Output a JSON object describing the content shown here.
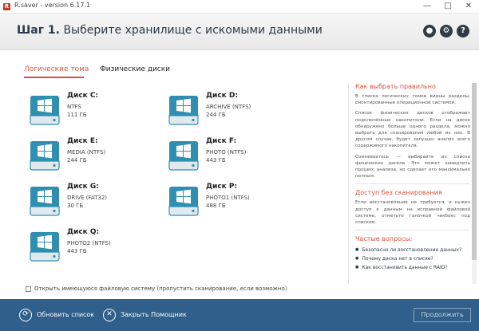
{
  "window": {
    "title": "R.saver - version 6.17.1",
    "logo": "R"
  },
  "header": {
    "step": "Шаг 1.",
    "title": "Выберите хранилище с искомыми данными"
  },
  "tabs": {
    "active": "Логические тома",
    "other": "Физические диски"
  },
  "disks": [
    {
      "name": "Диск C:",
      "fs": "NTFS",
      "size": "111 ГБ"
    },
    {
      "name": "Диск D:",
      "fs": "ARCHIVE (NTFS)",
      "size": "244 ГБ"
    },
    {
      "name": "Диск E:",
      "fs": "MEDIA (NTFS)",
      "size": "244 ГБ"
    },
    {
      "name": "Диск F:",
      "fs": "PHOTO (NTFS)",
      "size": "443 ГБ"
    },
    {
      "name": "Диск G:",
      "fs": "DRIVE (FAT32)",
      "size": "30 ГБ"
    },
    {
      "name": "Диск P:",
      "fs": "PHOTO1 (NTFS)",
      "size": "488 ГБ"
    },
    {
      "name": "Диск Q:",
      "fs": "PHOTO2 (NTFS)",
      "size": "443 ГБ"
    }
  ],
  "checkbox_label": "Открыть имеющуюся файловую систему (пропустить сканирование, если возможно)",
  "help": {
    "h1": "Как выбрать правильно",
    "p1": "В списке логических томов видны разделы, смонтированные операционной системой.",
    "p2": "Список физических дисков отображает подключённые накопители. Если на диске обнаружено больше одного раздела, можно выбрать для сканирования любой из них. В другом случае, будет запущен анализ всего содержимого накопителя.",
    "p3": "Сомневаетесь — выбирайте из списка физических дисков. Это может замедлить процесс анализа, но сделает его максимально полным.",
    "h2": "Доступ без сканирования",
    "p4": "Если восстановление не требуется, и нужен доступ к данным на исправной файловой системе, отметьте галочкой чекбокс под списком.",
    "h3": "Частые вопросы:",
    "questions": [
      "Безопасно ли восстановление данных?",
      "Почему диска нет в списке?",
      "Как восстановить данные с RAID?"
    ]
  },
  "footer": {
    "refresh": "Обновить список",
    "close": "Закрыть Помощник",
    "continue": "Продолжить"
  },
  "icons": {
    "user": "user-icon",
    "settings": "gear-icon",
    "help": "help-icon",
    "disk": "windows-disk-icon",
    "refresh": "refresh-icon",
    "close": "close-icon"
  },
  "colors": {
    "accent": "#d9533c",
    "footer": "#2f5f8a",
    "disk": "#2e8fb0"
  }
}
